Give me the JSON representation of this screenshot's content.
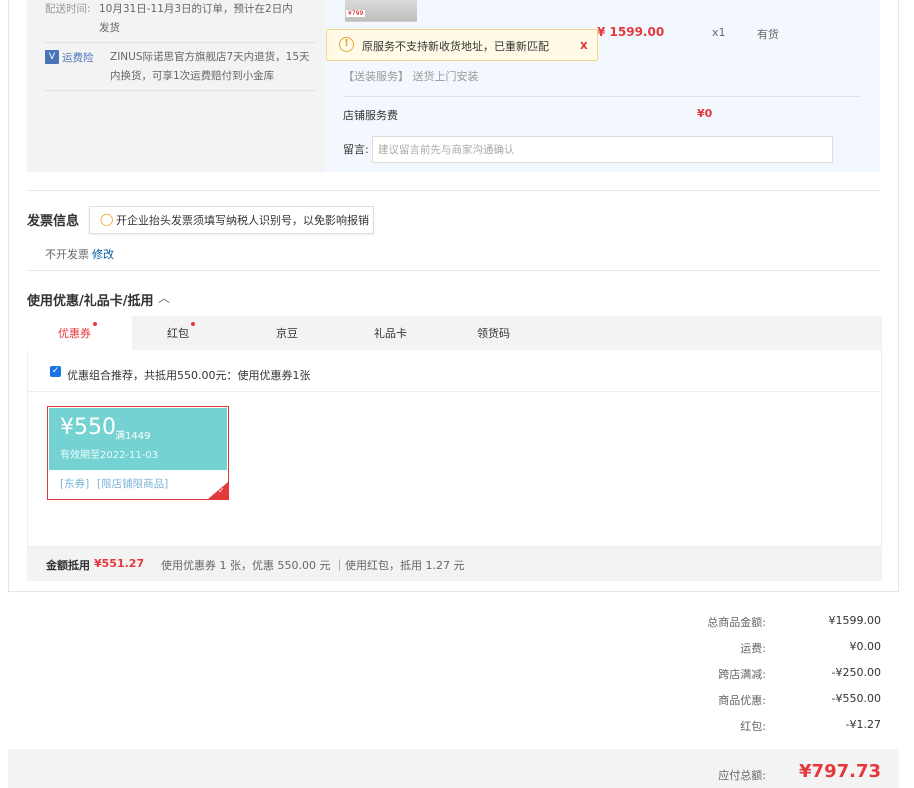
{
  "shipping": {
    "time_label": "配送时间:",
    "time_text": "10月31日-11月3日的订单，预计在2日内发货"
  },
  "insurance": {
    "icon": "shield-icon",
    "label": "运费险",
    "text": "ZINUS际诺思官方旗舰店7天内退货，15天内换货，可享1次运费赔付到小金库"
  },
  "product": {
    "price": "¥ 1599.00",
    "quantity": "x1",
    "stock": "有货",
    "service": "【送装服务】 送货上门安装",
    "thumb_tag": "¥799"
  },
  "address_tip": {
    "icon": "warning-icon",
    "text": "原服务不支持新收货地址，已重新匹配",
    "close": "x"
  },
  "store_fee": {
    "label": "店铺服务费",
    "value": "¥0"
  },
  "message": {
    "label": "留言:",
    "placeholder": "建议留言前先与商家沟通确认"
  },
  "invoice": {
    "title": "发票信息",
    "tip": "开企业抬头发票须填写纳税人识别号，以免影响报销",
    "value": "不开发票",
    "edit": "修改"
  },
  "coupons": {
    "title": "使用优惠/礼品卡/抵用",
    "caret": "︿",
    "tabs": [
      {
        "label": "优惠券",
        "dot": true,
        "active": true
      },
      {
        "label": "红包",
        "dot": true,
        "active": false
      },
      {
        "label": "京豆",
        "dot": false,
        "active": false
      },
      {
        "label": "礼品卡",
        "dot": false,
        "active": false
      },
      {
        "label": "领货码",
        "dot": false,
        "active": false
      }
    ],
    "recommend": "优惠组合推荐，共抵用550.00元：使用优惠券1张",
    "recommend_checked": true,
    "card": {
      "amount": "¥550",
      "min": "满1449",
      "valid": "有效期至2022-11-03",
      "tag1": "[东券]",
      "tag2": "[限店铺限商品]",
      "accent": "#75d2d3"
    },
    "summary_label": "金额抵用",
    "summary_value": "¥551.27",
    "summary_detail": "使用优惠券 1 张，优惠 550.00 元 ｜使用红包，抵用 1.27 元"
  },
  "totals": [
    {
      "label": "总商品金额:",
      "value": "¥1599.00"
    },
    {
      "label": "运费:",
      "value": "¥0.00"
    },
    {
      "label": "跨店满减:",
      "value": "-¥250.00"
    },
    {
      "label": "商品优惠:",
      "value": "-¥550.00"
    },
    {
      "label": "红包:",
      "value": "-¥1.27"
    }
  ],
  "payable": {
    "label": "应付总额:",
    "value": "¥797.73"
  },
  "colors": {
    "accent_red": "#e4393c",
    "link_blue": "#005ea7"
  }
}
